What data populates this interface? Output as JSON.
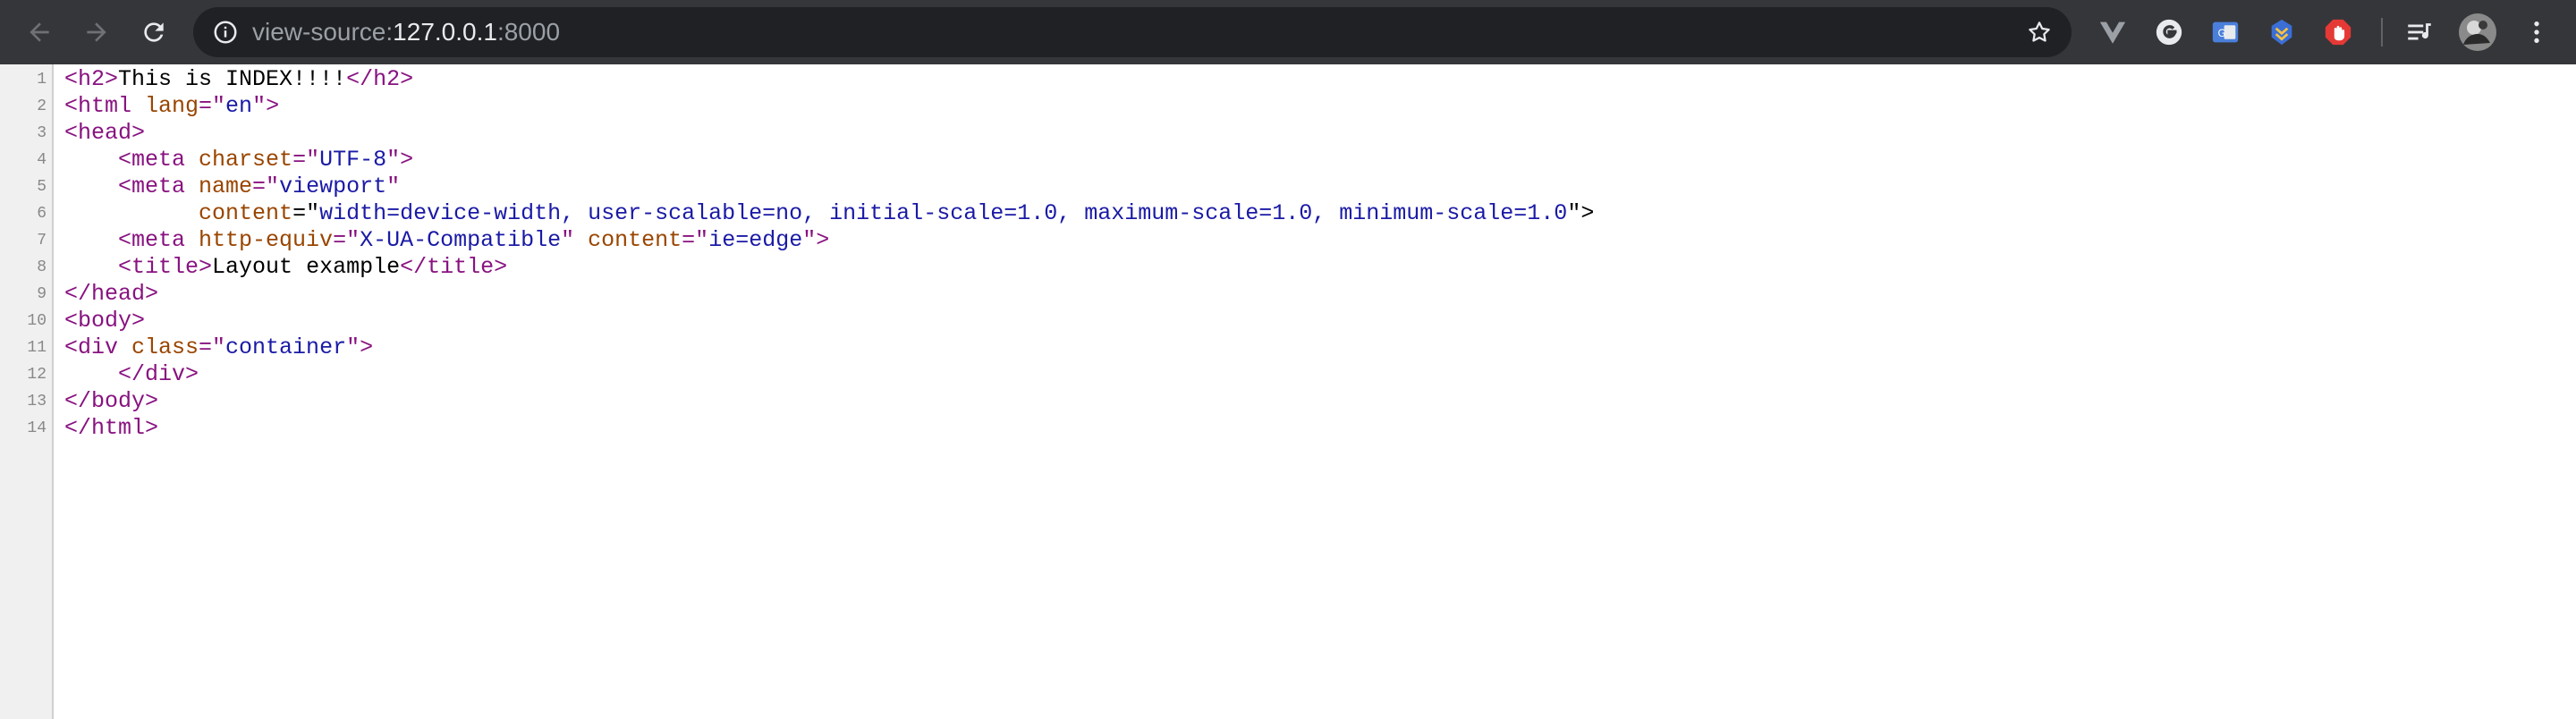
{
  "browser": {
    "url": {
      "scheme": "view-source:",
      "host": "127.0.0.1",
      "port": ":8000"
    },
    "icons": {
      "back": "back-arrow-icon",
      "forward": "forward-arrow-icon",
      "reload": "reload-icon",
      "info": "info-icon",
      "star": "bookmark-star-icon",
      "menu": "more-vert-icon"
    },
    "extensions": [
      {
        "name": "vue-devtools-extension-icon",
        "color": "#9aa0a6"
      },
      {
        "name": "grammarly-extension-icon",
        "color": "#e8eaed"
      },
      {
        "name": "translate-extension-icon",
        "color": "#4a7fdc"
      },
      {
        "name": "raindrop-extension-icon",
        "color": "#3b6fd6"
      },
      {
        "name": "adblock-extension-icon",
        "color": "#e53935"
      },
      {
        "name": "playlist-extension-icon",
        "color": "#e8eaed"
      },
      {
        "name": "profile-avatar",
        "color": "#cccccc"
      }
    ]
  },
  "source": {
    "line_numbers": [
      "1",
      "2",
      "3",
      "4",
      "5",
      "6",
      "7",
      "8",
      "9",
      "10",
      "11",
      "12",
      "13",
      "14"
    ],
    "lines": [
      [
        {
          "t": "tag",
          "v": "<h2>"
        },
        {
          "t": "txt",
          "v": "This is INDEX!!!!"
        },
        {
          "t": "tag",
          "v": "</h2>"
        }
      ],
      [
        {
          "t": "tag",
          "v": "<html "
        },
        {
          "t": "attr",
          "v": "lang"
        },
        {
          "t": "tag",
          "v": "=\""
        },
        {
          "t": "val",
          "v": "en"
        },
        {
          "t": "tag",
          "v": "\">"
        }
      ],
      [
        {
          "t": "tag",
          "v": "<head>"
        }
      ],
      [
        {
          "t": "txt",
          "v": "    "
        },
        {
          "t": "tag",
          "v": "<meta "
        },
        {
          "t": "attr",
          "v": "charset"
        },
        {
          "t": "tag",
          "v": "=\""
        },
        {
          "t": "val",
          "v": "UTF-8"
        },
        {
          "t": "tag",
          "v": "\">"
        }
      ],
      [
        {
          "t": "txt",
          "v": "    "
        },
        {
          "t": "tag",
          "v": "<meta "
        },
        {
          "t": "attr",
          "v": "name"
        },
        {
          "t": "tag",
          "v": "=\""
        },
        {
          "t": "val",
          "v": "viewport"
        },
        {
          "t": "tag",
          "v": "\""
        }
      ],
      [
        {
          "t": "txt",
          "v": "          "
        },
        {
          "t": "attr",
          "v": "content"
        },
        {
          "t": "txt",
          "v": "=\""
        },
        {
          "t": "val",
          "v": "width=device-width, user-scalable=no, initial-scale=1.0, maximum-scale=1.0, minimum-scale=1.0"
        },
        {
          "t": "txt",
          "v": "\">"
        }
      ],
      [
        {
          "t": "txt",
          "v": "    "
        },
        {
          "t": "tag",
          "v": "<meta "
        },
        {
          "t": "attr",
          "v": "http-equiv"
        },
        {
          "t": "tag",
          "v": "=\""
        },
        {
          "t": "val",
          "v": "X-UA-Compatible"
        },
        {
          "t": "tag",
          "v": "\" "
        },
        {
          "t": "attr",
          "v": "content"
        },
        {
          "t": "tag",
          "v": "=\""
        },
        {
          "t": "val",
          "v": "ie=edge"
        },
        {
          "t": "tag",
          "v": "\">"
        }
      ],
      [
        {
          "t": "txt",
          "v": "    "
        },
        {
          "t": "tag",
          "v": "<title>"
        },
        {
          "t": "txt",
          "v": "Layout example"
        },
        {
          "t": "tag",
          "v": "</title>"
        }
      ],
      [
        {
          "t": "tag",
          "v": "</head>"
        }
      ],
      [
        {
          "t": "tag",
          "v": "<body>"
        }
      ],
      [
        {
          "t": "tag",
          "v": "<div "
        },
        {
          "t": "attr",
          "v": "class"
        },
        {
          "t": "tag",
          "v": "=\""
        },
        {
          "t": "val",
          "v": "container"
        },
        {
          "t": "tag",
          "v": "\">"
        }
      ],
      [
        {
          "t": "txt",
          "v": "    "
        },
        {
          "t": "tag",
          "v": "</div>"
        }
      ],
      [
        {
          "t": "tag",
          "v": "</body>"
        }
      ],
      [
        {
          "t": "tag",
          "v": "</html>"
        }
      ]
    ]
  }
}
